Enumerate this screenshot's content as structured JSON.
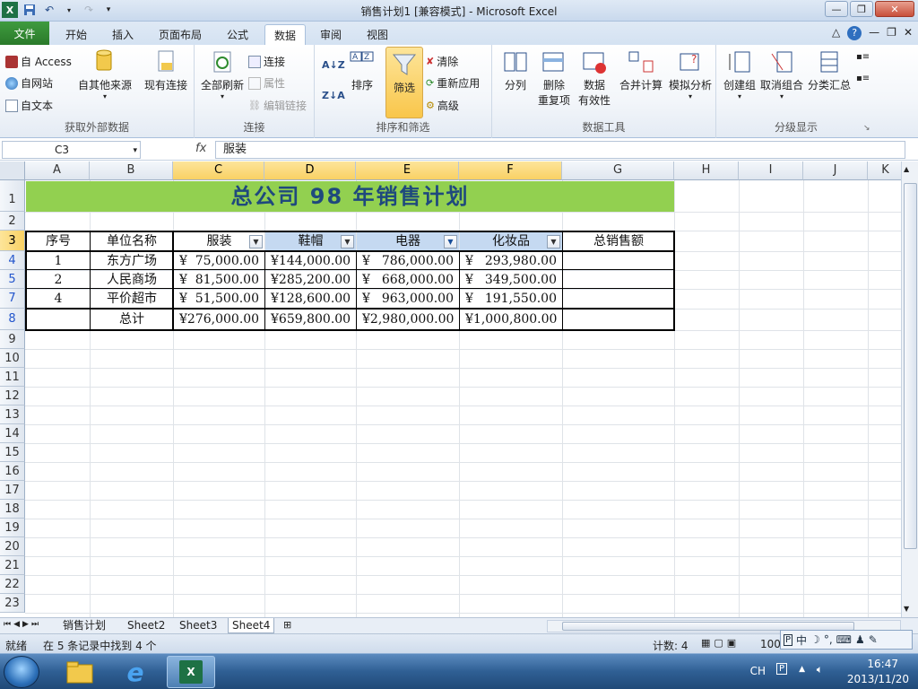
{
  "window": {
    "title": "销售计划1  [兼容模式]  -  Microsoft Excel",
    "app_icon": "excel-icon"
  },
  "ribbon_tabs": [
    "文件",
    "开始",
    "插入",
    "页面布局",
    "公式",
    "数据",
    "审阅",
    "视图"
  ],
  "active_tab": "数据",
  "ribbon": {
    "ext": {
      "access": "自 Access",
      "web": "自网站",
      "text": "自文本",
      "other": "自其他来源",
      "existing": "现有连接",
      "label": "获取外部数据"
    },
    "conn": {
      "refresh": "全部刷新",
      "connections": "连接",
      "properties": "属性",
      "edit_links": "编辑链接",
      "label": "连接"
    },
    "sort": {
      "sort": "排序",
      "filter": "筛选",
      "clear": "清除",
      "reapply": "重新应用",
      "advanced": "高级",
      "label": "排序和筛选"
    },
    "tools": {
      "split": "分列",
      "dedup1": "删除",
      "dedup2": "重复项",
      "valid1": "数据",
      "valid2": "有效性",
      "consolidate": "合并计算",
      "whatif": "模拟分析",
      "label": "数据工具"
    },
    "outline": {
      "group": "创建组",
      "ungroup": "取消组合",
      "subtotal": "分类汇总",
      "label": "分级显示"
    }
  },
  "formula_bar": {
    "name_box": "C3",
    "fx": "fx",
    "content": "服装"
  },
  "columns": [
    "A",
    "B",
    "C",
    "D",
    "E",
    "F",
    "G",
    "H",
    "I",
    "J",
    "K"
  ],
  "rows": [
    "1",
    "2",
    "3",
    "4",
    "5",
    "7",
    "8",
    "9",
    "10",
    "11",
    "12",
    "13",
    "14",
    "15",
    "16",
    "17",
    "18",
    "19",
    "20",
    "21",
    "22",
    "23"
  ],
  "sheet": {
    "title": "总公司 98 年销售计划",
    "headers": [
      "序号",
      "单位名称",
      "服装",
      "鞋帽",
      "电器",
      "化妆品",
      "总销售额"
    ],
    "data": [
      {
        "no": "1",
        "name": "东方广场",
        "c": "75,000.00",
        "d": "144,000.00",
        "e": "786,000.00",
        "f": "293,980.00"
      },
      {
        "no": "2",
        "name": "人民商场",
        "c": "81,500.00",
        "d": "285,200.00",
        "e": "668,000.00",
        "f": "349,500.00"
      },
      {
        "no": "4",
        "name": "平价超市",
        "c": "51,500.00",
        "d": "128,600.00",
        "e": "963,000.00",
        "f": "191,550.00"
      }
    ],
    "total": {
      "label": "总计",
      "c": "276,000.00",
      "d": "659,800.00",
      "e": "2,980,000.00",
      "f": "1,000,800.00"
    },
    "currency": "¥"
  },
  "sheet_tabs": [
    "销售计划",
    "Sheet2",
    "Sheet3",
    "Sheet4"
  ],
  "active_sheet": "Sheet4",
  "status": {
    "ready": "就绪",
    "found": "在 5 条记录中找到 4 个",
    "count": "计数: 4",
    "zoom": "100"
  },
  "ime": {
    "lang": "中"
  },
  "taskbar": {
    "lang": "CH",
    "time": "16:47",
    "date": "2013/11/20"
  }
}
